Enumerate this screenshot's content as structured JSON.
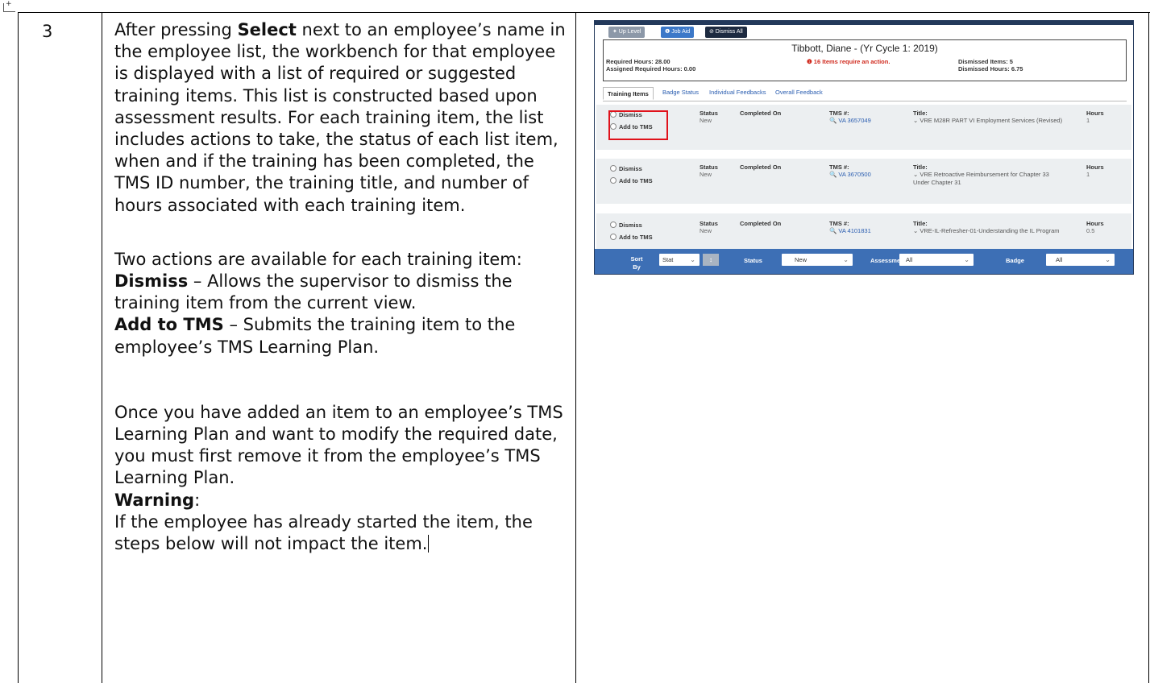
{
  "step": {
    "number": "3"
  },
  "instructions": {
    "para1_pre": "After pressing ",
    "para1_bold": "Select",
    "para1_post": " next to an employee’s name in the employee list, the workbench for that employee is displayed with a list of required or suggested training items.  This list is constructed based upon assessment results.  For each training item, the list includes actions to take, the status of each list item, when and if the training has been completed, the TMS ID number, the training title, and number of hours associated with each training item.",
    "para2": "Two actions are available for each training item:",
    "dismiss_bold": "Dismiss",
    "dismiss_text": " – Allows the supervisor to dismiss the training item from the current view.",
    "add_bold": "Add to TMS",
    "add_text": " – Submits the training item to the employee’s TMS Learning Plan.",
    "para3": "Once you have added an item to an employee’s TMS Learning Plan and want to modify the required date, you must first remove it from the employee’s TMS Learning Plan.",
    "warning_bold": "Warning",
    "warning_colon": ":",
    "warning_text": "If the employee has already started the item, the steps below will not impact the item."
  },
  "screenshot": {
    "toolbar": {
      "up_level": "✦ Up Level",
      "job_aid": "❶ Job Aid",
      "dismiss_all": "⊘ Dismiss All"
    },
    "header": {
      "name": "Tibbott, Diane - (Yr Cycle 1: 2019)",
      "required_hours": "Required Hours: 28.00",
      "assigned_hours": "Assigned Required Hours: 0.00",
      "warning": "❶ 16 Items require an action.",
      "dismissed_items": "Dismissed Items: 5",
      "dismissed_hours": "Dismissed Hours: 6.75"
    },
    "tabs": [
      "Training Items",
      "Badge Status",
      "Individual Feedbacks",
      "Overall Feedback"
    ],
    "labels": {
      "dismiss": "Dismiss",
      "add_to_tms": "Add to TMS",
      "status": "Status",
      "completed_on": "Completed On",
      "tms": "TMS #:",
      "title": "Title:",
      "hours": "Hours"
    },
    "items": [
      {
        "status": "New",
        "tms": "🔍 VA 3657049",
        "title": "⌄ VRE M28R PART VI Employment Services (Revised)",
        "hours": "1"
      },
      {
        "status": "New",
        "tms": "🔍 VA 3670500",
        "title": "⌄ VRE Retroactive Reimbursement for Chapter 33 Under Chapter 31",
        "hours": "1"
      },
      {
        "status": "New",
        "tms": "🔍 VA 4101831",
        "title": "⌄ VRE-IL-Refresher-01-Understanding the IL Program",
        "hours": "0.5"
      }
    ],
    "footer": {
      "sort_by": "Sort By",
      "sort_value": "Stat",
      "sort_dir": "↕",
      "status_label": "Status",
      "status_value": "New",
      "assessment_label": "Assessment",
      "assessment_value": "All",
      "badge_label": "Badge",
      "badge_value": "All"
    },
    "colors": {
      "toolbar_bg": "#23395b",
      "footer_bg": "#3d6fb5",
      "highlight": "#e0121b",
      "link": "#2a5db0",
      "warning": "#d02a1e"
    }
  }
}
